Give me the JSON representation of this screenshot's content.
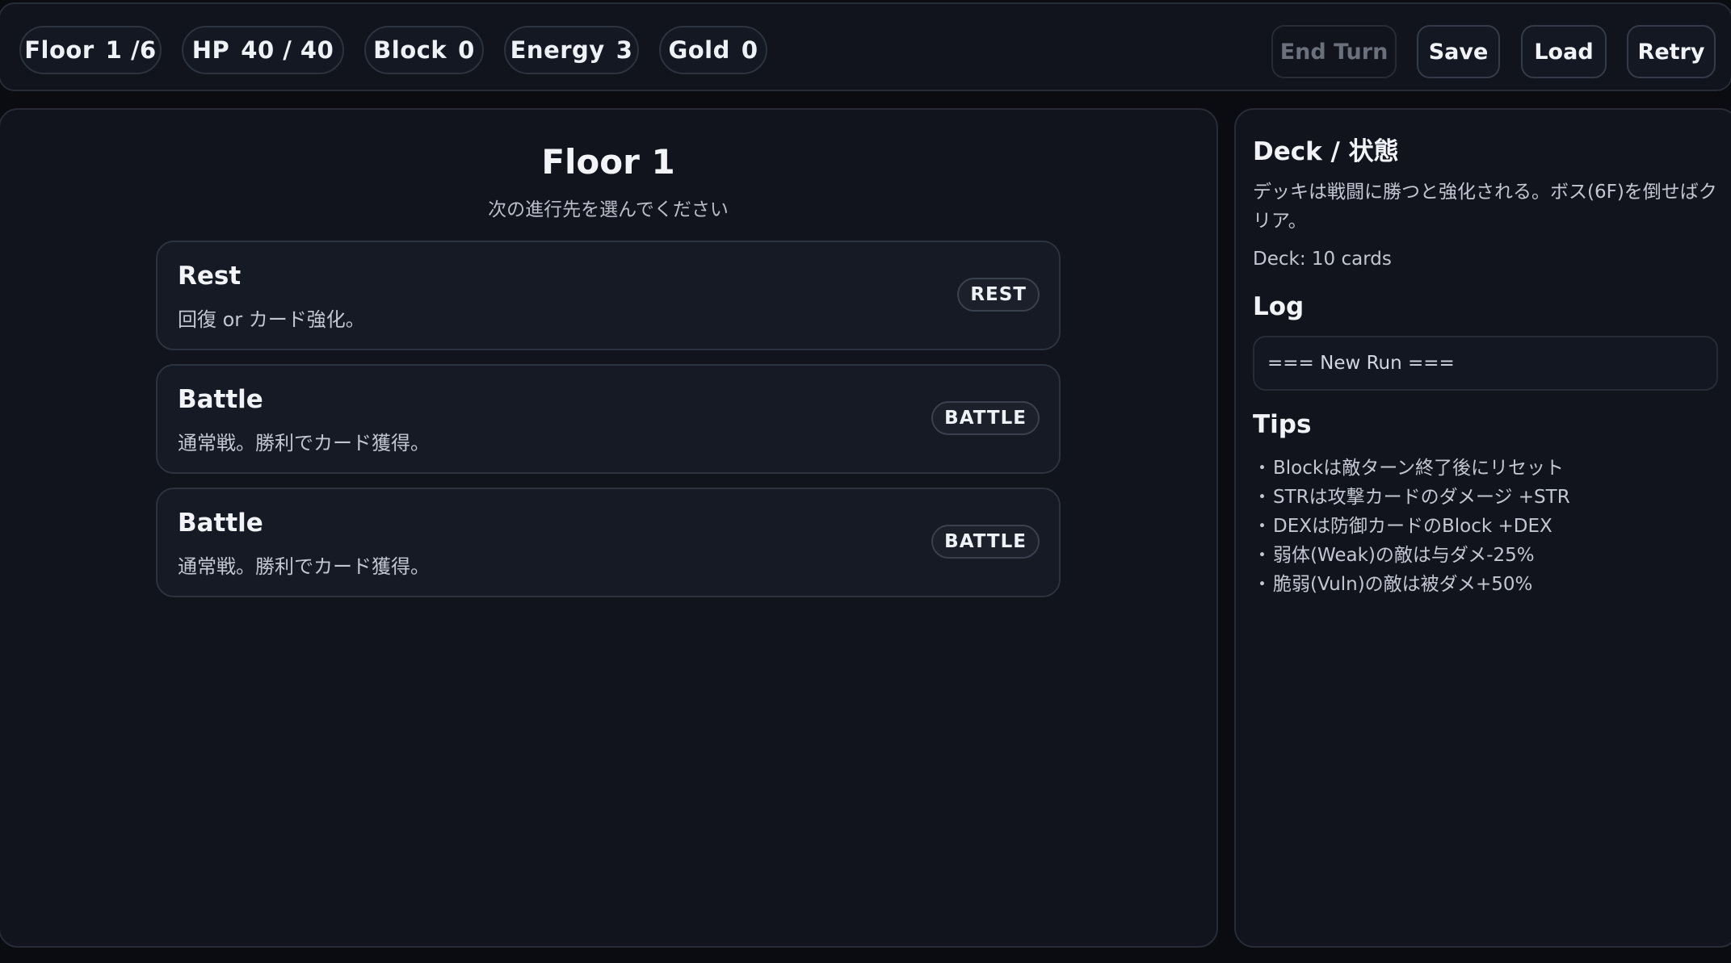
{
  "status": {
    "floor": {
      "label": "Floor",
      "current": "1",
      "max": "/6"
    },
    "hp": {
      "label": "HP",
      "value": "40 / 40"
    },
    "block": {
      "label": "Block",
      "value": "0"
    },
    "energy": {
      "label": "Energy",
      "value": "3"
    },
    "gold": {
      "label": "Gold",
      "value": "0"
    }
  },
  "controls": {
    "end_turn": "End Turn",
    "save": "Save",
    "load": "Load",
    "retry": "Retry"
  },
  "map": {
    "title": "Floor 1",
    "subtitle": "次の進行先を選んでください",
    "nodes": [
      {
        "title": "Rest",
        "desc": "回復 or カード強化。",
        "badge": "REST"
      },
      {
        "title": "Battle",
        "desc": "通常戦。勝利でカード獲得。",
        "badge": "BATTLE"
      },
      {
        "title": "Battle",
        "desc": "通常戦。勝利でカード獲得。",
        "badge": "BATTLE"
      }
    ]
  },
  "sidebar": {
    "deck_heading": "Deck / 状態",
    "deck_desc": "デッキは戦闘に勝つと強化される。ボス(6F)を倒せばクリア。",
    "deck_count": "Deck: 10 cards",
    "log_heading": "Log",
    "log_entries": [
      "=== New Run ==="
    ],
    "tips_heading": "Tips",
    "tips": [
      "Blockは敵ターン終了後にリセット",
      "STRは攻撃カードのダメージ +STR",
      "DEXは防御カードのBlock +DEX",
      "弱体(Weak)の敵は与ダメ-25%",
      "脆弱(Vuln)の敵は被ダメ+50%"
    ]
  }
}
